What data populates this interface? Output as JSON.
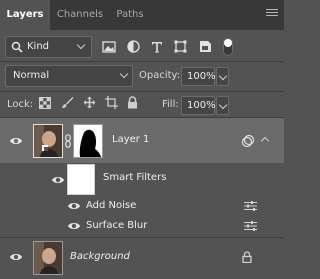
{
  "tabs": [
    {
      "label": "Layers",
      "active": true
    },
    {
      "label": "Channels",
      "active": false
    },
    {
      "label": "Paths",
      "active": false
    }
  ],
  "filter": {
    "kind_label": "Kind",
    "icons": [
      "pixel-filter-icon",
      "adjustment-filter-icon",
      "type-filter-icon",
      "shape-filter-icon",
      "smart-object-filter-icon",
      "filter-toggle-icon"
    ]
  },
  "blend": {
    "mode": "Normal",
    "opacity_label": "Opacity:",
    "opacity_value": "100%"
  },
  "locks": {
    "label": "Lock:",
    "fill_label": "Fill:",
    "fill_value": "100%",
    "icons": [
      "lock-transparent-pixels-icon",
      "lock-image-pixels-icon",
      "lock-position-icon",
      "lock-artboard-icon",
      "lock-all-icon"
    ]
  },
  "layers": {
    "layer1": {
      "name": "Layer 1"
    },
    "smart_filters": {
      "label": "Smart Filters"
    },
    "filters": [
      {
        "name": "Add Noise"
      },
      {
        "name": "Surface Blur"
      }
    ],
    "background": {
      "name": "Background"
    }
  },
  "colors": {
    "panel": "#535353",
    "tab_bar": "#383838",
    "selected_row": "#6b6b6b"
  }
}
